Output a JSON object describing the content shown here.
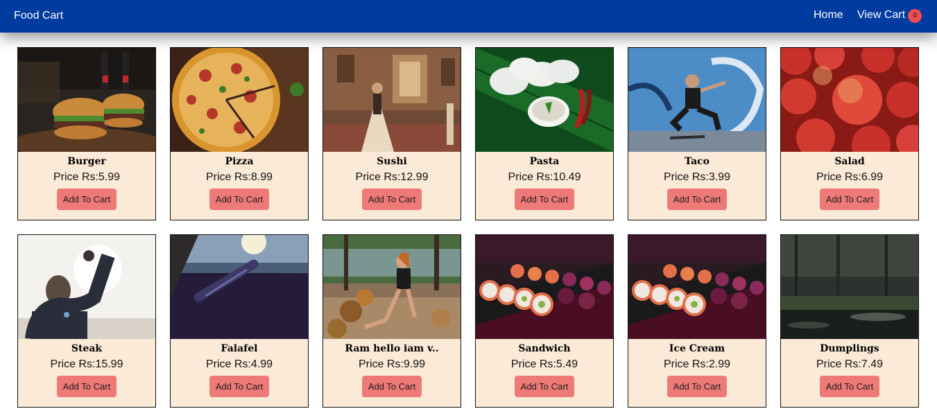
{
  "navbar": {
    "brand": "Food Cart",
    "home_label": "Home",
    "cart_label": "View Cart",
    "cart_count": "0"
  },
  "products": [
    {
      "name": "Burger",
      "price": "Price Rs:5.99",
      "button": "Add To Cart",
      "image": "burger-photo"
    },
    {
      "name": "Pizza",
      "price": "Price Rs:8.99",
      "button": "Add To Cart",
      "image": "pizza-photo"
    },
    {
      "name": "Sushi",
      "price": "Price Rs:12.99",
      "button": "Add To Cart",
      "image": "palace-dancer-photo"
    },
    {
      "name": "Pasta",
      "price": "Price Rs:10.49",
      "button": "Add To Cart",
      "image": "idli-plate-photo"
    },
    {
      "name": "Taco",
      "price": "Price Rs:3.99",
      "button": "Add To Cart",
      "image": "skater-graffiti-photo"
    },
    {
      "name": "Salad",
      "price": "Price Rs:6.99",
      "button": "Add To Cart",
      "image": "apples-photo"
    },
    {
      "name": "Steak",
      "price": "Price Rs:15.99",
      "button": "Add To Cart",
      "image": "man-raised-fist-photo"
    },
    {
      "name": "Falafel",
      "price": "Price Rs:4.99",
      "button": "Add To Cart",
      "image": "cannon-seaside-photo"
    },
    {
      "name": "Ram hello iam v..",
      "price": "Price Rs:9.99",
      "button": "Add To Cart",
      "image": "woman-autumn-leaves-photo"
    },
    {
      "name": "Sandwich",
      "price": "Price Rs:5.49",
      "button": "Add To Cart",
      "image": "sushi-rolls-photo"
    },
    {
      "name": "Ice Cream",
      "price": "Price Rs:2.99",
      "button": "Add To Cart",
      "image": "sushi-rolls-photo"
    },
    {
      "name": "Dumplings",
      "price": "Price Rs:7.49",
      "button": "Add To Cart",
      "image": "dark-pond-photo"
    }
  ]
}
